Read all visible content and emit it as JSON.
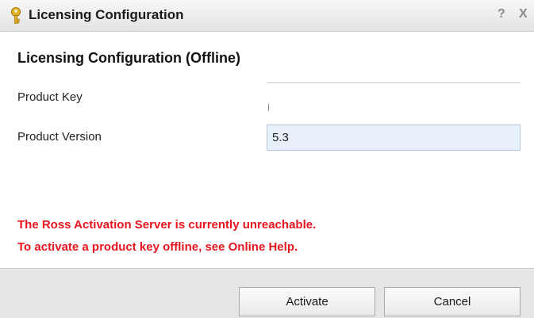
{
  "window": {
    "title": "Licensing Configuration",
    "help_label": "?",
    "close_label": "X"
  },
  "form": {
    "heading": "Licensing Configuration (Offline)",
    "product_key_label": "Product Key",
    "product_key_value": "",
    "product_version_label": "Product Version",
    "product_version_value": "5.3"
  },
  "messages": {
    "line1": "The Ross Activation Server is currently unreachable.",
    "line2": "To activate a product key offline, see Online Help."
  },
  "buttons": {
    "activate_label": "Activate",
    "cancel_label": "Cancel"
  },
  "colors": {
    "error": "#e8141e",
    "input_background": "#e8f0fc",
    "key_icon": "#d9a520"
  },
  "icons": {
    "title_icon": "key-icon"
  }
}
